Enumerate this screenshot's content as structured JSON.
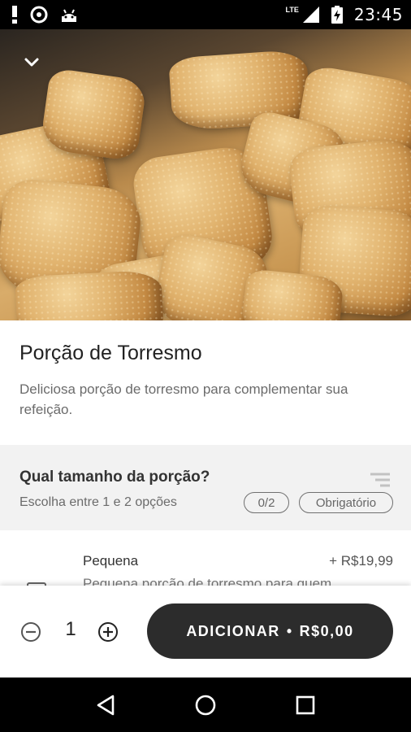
{
  "status_bar": {
    "time": "23:45",
    "network": "LTE",
    "icons": [
      "alert-icon",
      "pocket-cast-icon",
      "android-icon",
      "signal-icon",
      "battery-charging-icon"
    ]
  },
  "hero": {
    "image": "fried-pork-rinds-photo",
    "back_icon": "chevron-down-icon"
  },
  "product": {
    "title": "Porção de Torresmo",
    "description": "Deliciosa porção de torresmo para complementar sua refeição."
  },
  "options_section": {
    "title": "Qual tamanho da porção?",
    "subtitle": "Escolha entre 1 e 2 opções",
    "count_badge": "0/2",
    "required_badge": "Obrigatório"
  },
  "option": {
    "name": "Pequena",
    "price": "+ R$19,99",
    "description": "Pequena porção de torresmo para quem"
  },
  "cart": {
    "quantity": "1",
    "add_label": "ADICIONAR",
    "separator": "•",
    "total": "R$0,00"
  },
  "colors": {
    "button": "#2c2c2c",
    "section_bg": "#f2f2f2"
  }
}
